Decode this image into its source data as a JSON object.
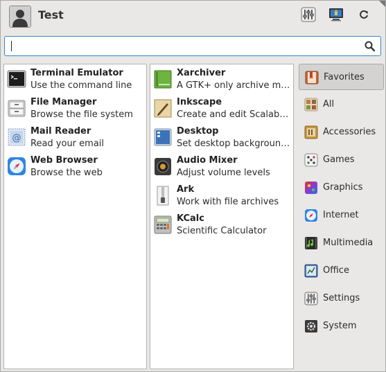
{
  "header": {
    "user_name": "Test",
    "buttons": [
      {
        "name": "settings-manager-button",
        "icon": "settings-sliders-icon"
      },
      {
        "name": "lock-screen-button",
        "icon": "monitor-lock-icon"
      },
      {
        "name": "log-out-button",
        "icon": "power-refresh-icon"
      }
    ]
  },
  "search": {
    "value": "",
    "placeholder": ""
  },
  "favorites": [
    {
      "name": "Terminal Emulator",
      "desc": "Use the command line",
      "icon": "terminal-icon"
    },
    {
      "name": "File Manager",
      "desc": "Browse the file system",
      "icon": "file-cabinet-icon"
    },
    {
      "name": "Mail Reader",
      "desc": "Read your email",
      "icon": "mail-stamp-icon"
    },
    {
      "name": "Web Browser",
      "desc": "Browse the web",
      "icon": "compass-icon"
    }
  ],
  "recent": [
    {
      "name": "Xarchiver",
      "desc": "A GTK+ only archive manager",
      "icon": "green-archive-icon"
    },
    {
      "name": "Inkscape",
      "desc": "Create and edit Scalable Vector Graphics",
      "icon": "inkscape-pen-icon"
    },
    {
      "name": "Desktop",
      "desc": "Set desktop background and menu",
      "icon": "desktop-icon"
    },
    {
      "name": "Audio Mixer",
      "desc": "Adjust volume levels",
      "icon": "speaker-icon"
    },
    {
      "name": "Ark",
      "desc": "Work with file archives",
      "icon": "zipper-icon"
    },
    {
      "name": "KCalc",
      "desc": "Scientific Calculator",
      "icon": "calculator-icon"
    }
  ],
  "categories": [
    {
      "label": "Favorites",
      "icon": "bookmark-icon",
      "active": true
    },
    {
      "label": "All",
      "icon": "all-apps-icon"
    },
    {
      "label": "Accessories",
      "icon": "accessories-icon"
    },
    {
      "label": "Games",
      "icon": "dice-icon"
    },
    {
      "label": "Graphics",
      "icon": "palette-icon"
    },
    {
      "label": "Internet",
      "icon": "globe-icon"
    },
    {
      "label": "Multimedia",
      "icon": "music-note-icon"
    },
    {
      "label": "Office",
      "icon": "office-icon"
    },
    {
      "label": "Settings",
      "icon": "sliders-icon"
    },
    {
      "label": "System",
      "icon": "system-gear-icon"
    }
  ],
  "colors": {
    "accent": "#3584c8",
    "background": "#e9e8e6",
    "panel": "#ffffff"
  }
}
